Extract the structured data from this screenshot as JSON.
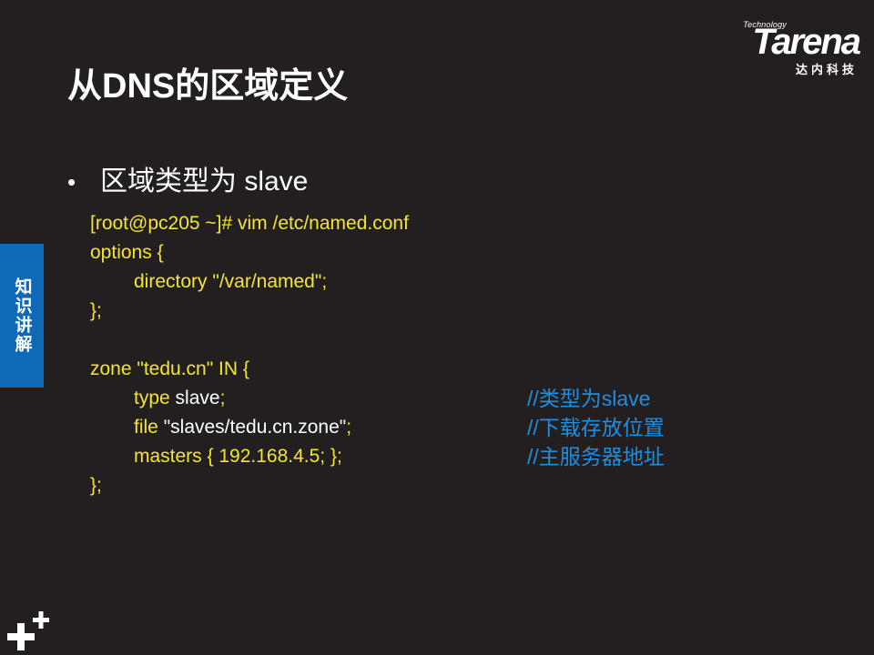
{
  "logo": {
    "technology": "Technology",
    "wordmark": "Tarena",
    "cn": "达内科技"
  },
  "title": "从DNS的区域定义",
  "bullet": {
    "symbol": "•",
    "text": "区域类型为 slave"
  },
  "side_tab": "知识讲解",
  "code": {
    "l1": "[root@pc205 ~]# vim  /etc/named.conf",
    "l2": "options {",
    "l3": "directory  \"/var/named\";",
    "l4": "};",
    "l5": "zone \"tedu.cn\" IN {",
    "l6_key": "type",
    "l6_val": " slave",
    "l6_end": ";",
    "l7_key": "file",
    "l7_val": " \"slaves/tedu.cn.zone\"",
    "l7_end": ";",
    "l8": "masters { 192.168.4.5; };",
    "l9": "};"
  },
  "comments": {
    "c1": "//类型为slave",
    "c2": "//下载存放位置",
    "c3": "//主服务器地址"
  },
  "colors": {
    "background": "#231f20",
    "code_yellow": "#f4e62e",
    "comment_blue": "#1e8fe0",
    "tab_blue": "#0e6ab6"
  }
}
